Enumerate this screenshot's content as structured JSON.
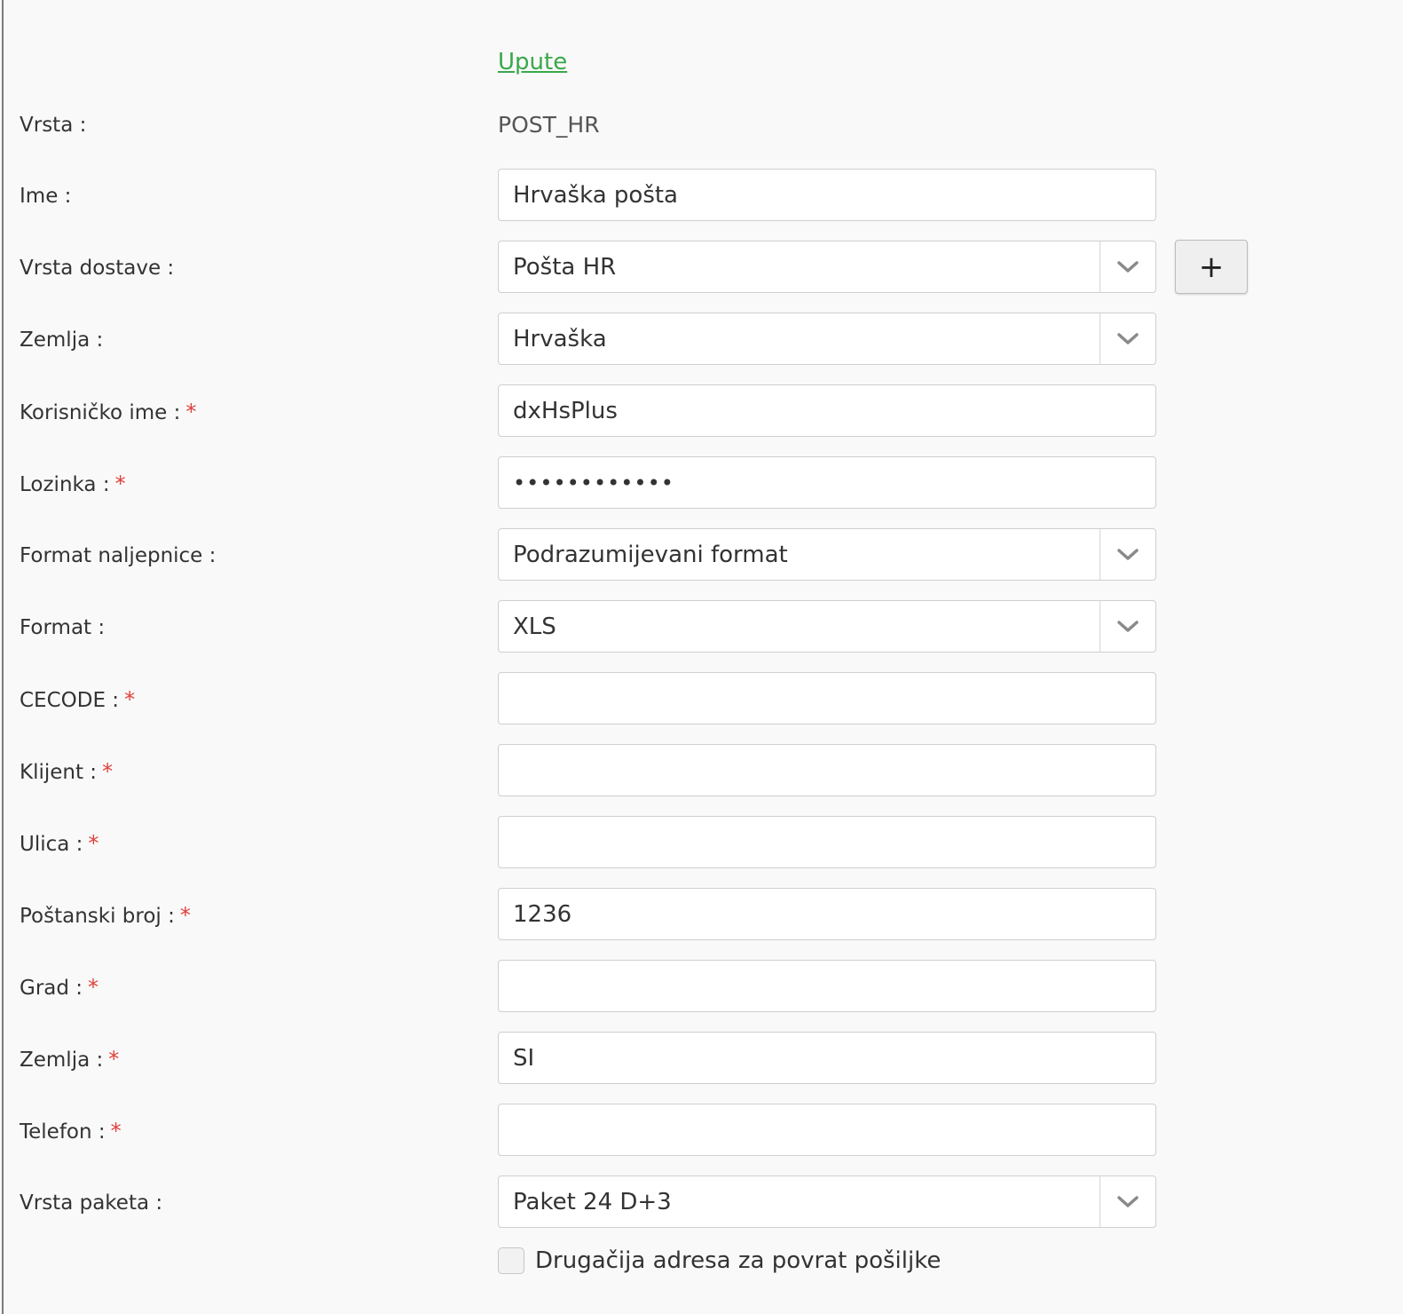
{
  "instructions_link": "Upute",
  "add_button_label": "+",
  "fields": {
    "vrsta": {
      "label": "Vrsta :",
      "value": "POST_HR"
    },
    "ime": {
      "label": "Ime :",
      "value": "Hrvaška pošta"
    },
    "vrsta_dostave": {
      "label": "Vrsta dostave :",
      "value": "Pošta HR"
    },
    "zemlja_select": {
      "label": "Zemlja :",
      "value": "Hrvaška"
    },
    "korisnicko_ime": {
      "label": "Korisničko ime :",
      "value": "dxHsPlus"
    },
    "lozinka": {
      "label": "Lozinka :",
      "value": "••••••••••••"
    },
    "format_naljepnice": {
      "label": "Format naljepnice :",
      "value": "Podrazumijevani format"
    },
    "format": {
      "label": "Format :",
      "value": "XLS"
    },
    "cecode": {
      "label": "CECODE :",
      "value": ""
    },
    "klijent": {
      "label": "Klijent :",
      "value": ""
    },
    "ulica": {
      "label": "Ulica :",
      "value": ""
    },
    "postanski_broj": {
      "label": "Poštanski broj :",
      "value": "1236"
    },
    "grad": {
      "label": "Grad :",
      "value": ""
    },
    "zemlja_text": {
      "label": "Zemlja :",
      "value": "SI"
    },
    "telefon": {
      "label": "Telefon :",
      "value": ""
    },
    "vrsta_paketa": {
      "label": "Vrsta paketa :",
      "value": "Paket 24 D+3"
    }
  },
  "required_marker": "*",
  "return_address_checkbox": {
    "label": "Drugačija adresa za povrat pošiljke",
    "checked": false
  }
}
